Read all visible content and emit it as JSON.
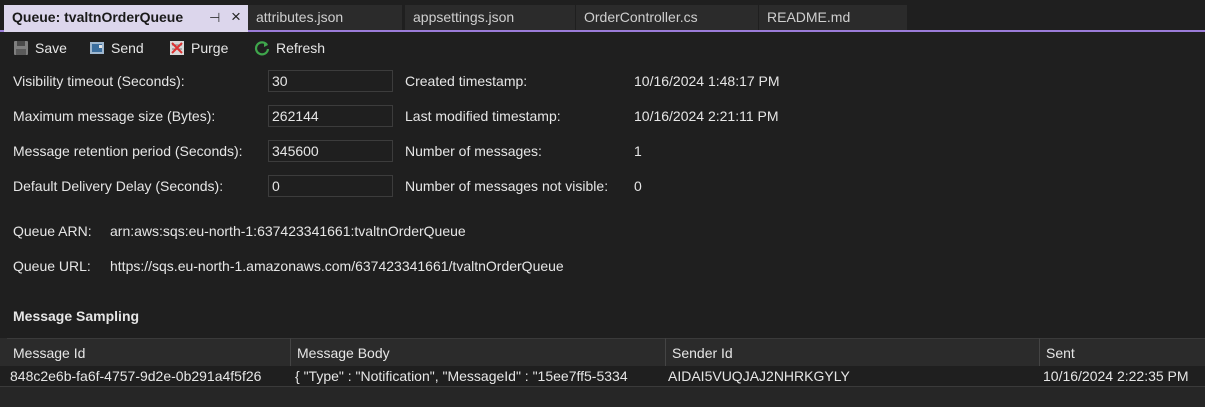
{
  "tabs": [
    {
      "label": "Queue: tvaltnOrderQueue",
      "active": true
    },
    {
      "label": "attributes.json"
    },
    {
      "label": "appsettings.json"
    },
    {
      "label": "OrderController.cs"
    },
    {
      "label": "README.md"
    }
  ],
  "tab_icons": {
    "pin": "pin-icon",
    "close": "close-icon"
  },
  "toolbar": {
    "save": "Save",
    "send": "Send",
    "purge": "Purge",
    "refresh": "Refresh"
  },
  "attributes": {
    "visibility_timeout": {
      "label": "Visibility timeout (Seconds):",
      "value": "30"
    },
    "max_message_size": {
      "label": "Maximum message size (Bytes):",
      "value": "262144"
    },
    "retention_period": {
      "label": "Message retention period (Seconds):",
      "value": "345600"
    },
    "delivery_delay": {
      "label": "Default Delivery Delay (Seconds):",
      "value": "0"
    }
  },
  "info": {
    "created": {
      "label": "Created timestamp:",
      "value": "10/16/2024 1:48:17 PM"
    },
    "modified": {
      "label": "Last modified timestamp:",
      "value": "10/16/2024 2:21:11 PM"
    },
    "num_messages": {
      "label": "Number of messages:",
      "value": "1"
    },
    "num_not_visible": {
      "label": "Number of messages not visible:",
      "value": "0"
    }
  },
  "queue": {
    "arn_label": "Queue ARN:",
    "arn": "arn:aws:sqs:eu-north-1:637423341661:tvaltnOrderQueue",
    "url_label": "Queue URL:",
    "url": "https://sqs.eu-north-1.amazonaws.com/637423341661/tvaltnOrderQueue"
  },
  "sampling": {
    "title": "Message Sampling",
    "columns": [
      "Message Id",
      "Message Body",
      "Sender Id",
      "Sent"
    ],
    "rows": [
      [
        "848c2e6b-fa6f-4757-9d2e-0b291a4f5f26",
        "{   \"Type\" : \"Notification\",   \"MessageId\" : \"15ee7ff5-5334",
        "AIDAI5VUQJAJ2NHRKGYLY",
        "10/16/2024 2:22:35 PM"
      ]
    ]
  },
  "colors": {
    "accent": "#9b7cd8",
    "background": "#1f1f1f",
    "active_tab": "#dcd6ec"
  }
}
